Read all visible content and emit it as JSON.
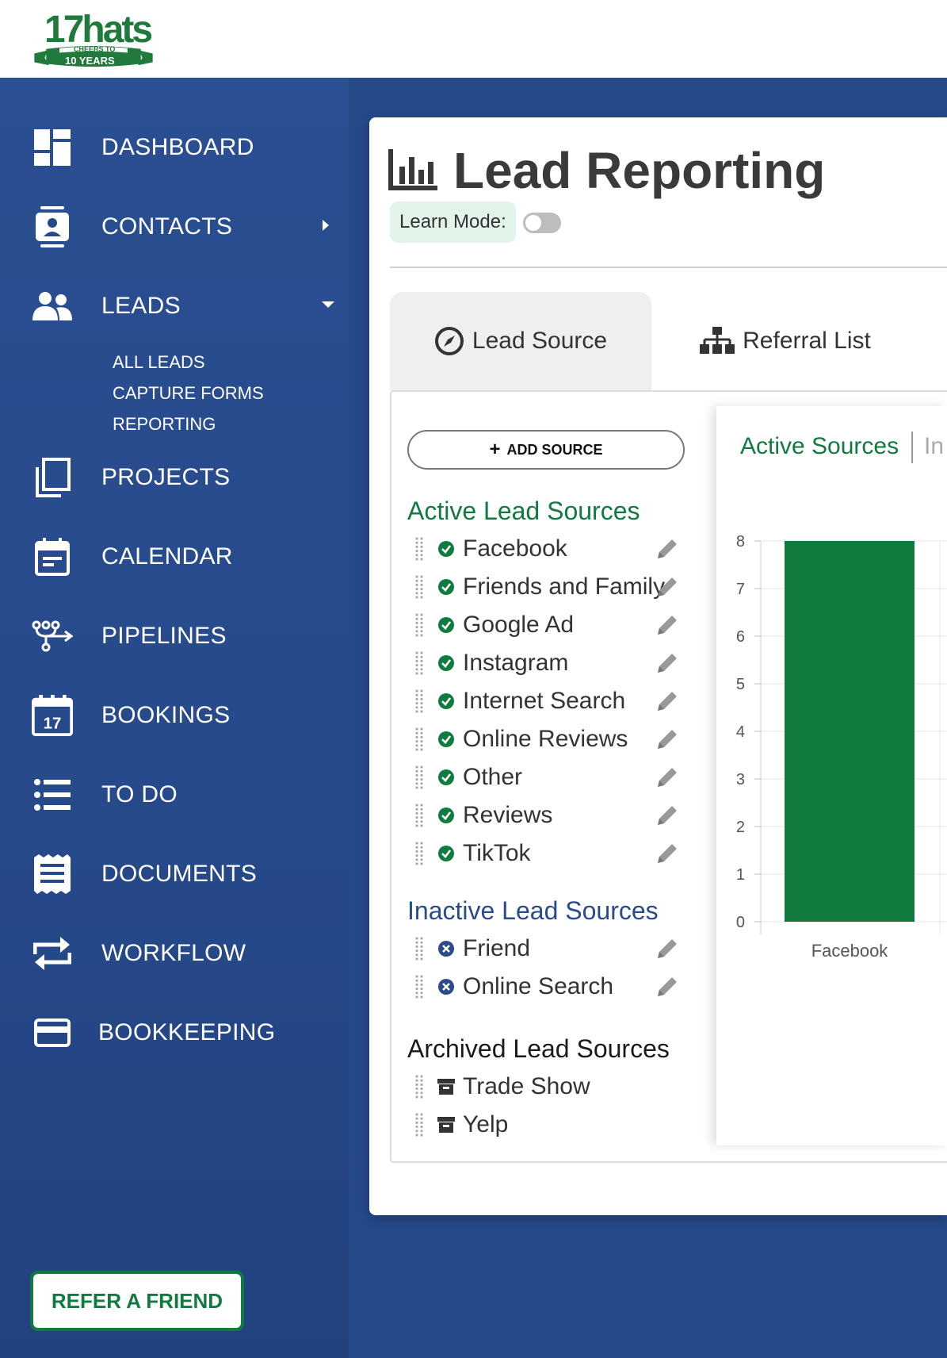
{
  "logo": {
    "brand": "17hats",
    "tagline1": "CHEERS TO",
    "tagline2": "10 YEARS"
  },
  "sidebar": {
    "items": [
      {
        "label": "DASHBOARD",
        "icon": "dashboard-icon"
      },
      {
        "label": "CONTACTS",
        "icon": "contacts-icon",
        "caret": "right"
      },
      {
        "label": "LEADS",
        "icon": "leads-icon",
        "caret": "down"
      },
      {
        "label": "PROJECTS",
        "icon": "projects-icon"
      },
      {
        "label": "CALENDAR",
        "icon": "calendar-icon"
      },
      {
        "label": "PIPELINES",
        "icon": "pipelines-icon"
      },
      {
        "label": "BOOKINGS",
        "icon": "bookings-icon",
        "badge": "17"
      },
      {
        "label": "TO DO",
        "icon": "todo-icon"
      },
      {
        "label": "DOCUMENTS",
        "icon": "documents-icon"
      },
      {
        "label": "WORKFLOW",
        "icon": "workflow-icon"
      },
      {
        "label": "BOOKKEEPING",
        "icon": "bookkeeping-icon"
      }
    ],
    "lead_subitems": [
      "ALL LEADS",
      "CAPTURE FORMS",
      "REPORTING"
    ],
    "refer_label": "REFER A FRIEND"
  },
  "page": {
    "title": "Lead Reporting",
    "learn_mode_label": "Learn Mode:",
    "learn_mode_on": false,
    "tabs": [
      {
        "label": "Lead Source",
        "icon": "compass-icon",
        "active": true
      },
      {
        "label": "Referral List",
        "icon": "sitemap-icon",
        "active": false
      }
    ]
  },
  "sources": {
    "add_label": "ADD SOURCE",
    "active_heading": "Active Lead Sources",
    "active": [
      "Facebook",
      "Friends and Family",
      "Google Ad",
      "Instagram",
      "Internet Search",
      "Online Reviews",
      "Other",
      "Reviews",
      "TikTok"
    ],
    "inactive_heading": "Inactive Lead Sources",
    "inactive": [
      "Friend",
      "Online Search"
    ],
    "archived_heading": "Archived Lead Sources",
    "archived": [
      "Trade Show",
      "Yelp"
    ]
  },
  "chart_tabs": {
    "active": "Active Sources",
    "other": "In"
  },
  "colors": {
    "sidebar": "#26498a",
    "accent_green": "#117a3e",
    "inactive_blue": "#2a4b8a"
  },
  "chart_data": {
    "type": "bar",
    "categories": [
      "Facebook"
    ],
    "values": [
      8
    ],
    "ylim": [
      0,
      8
    ],
    "yticks": [
      0,
      1,
      2,
      3,
      4,
      5,
      6,
      7,
      8
    ],
    "grid": true,
    "bar_color": "#117a3e"
  }
}
